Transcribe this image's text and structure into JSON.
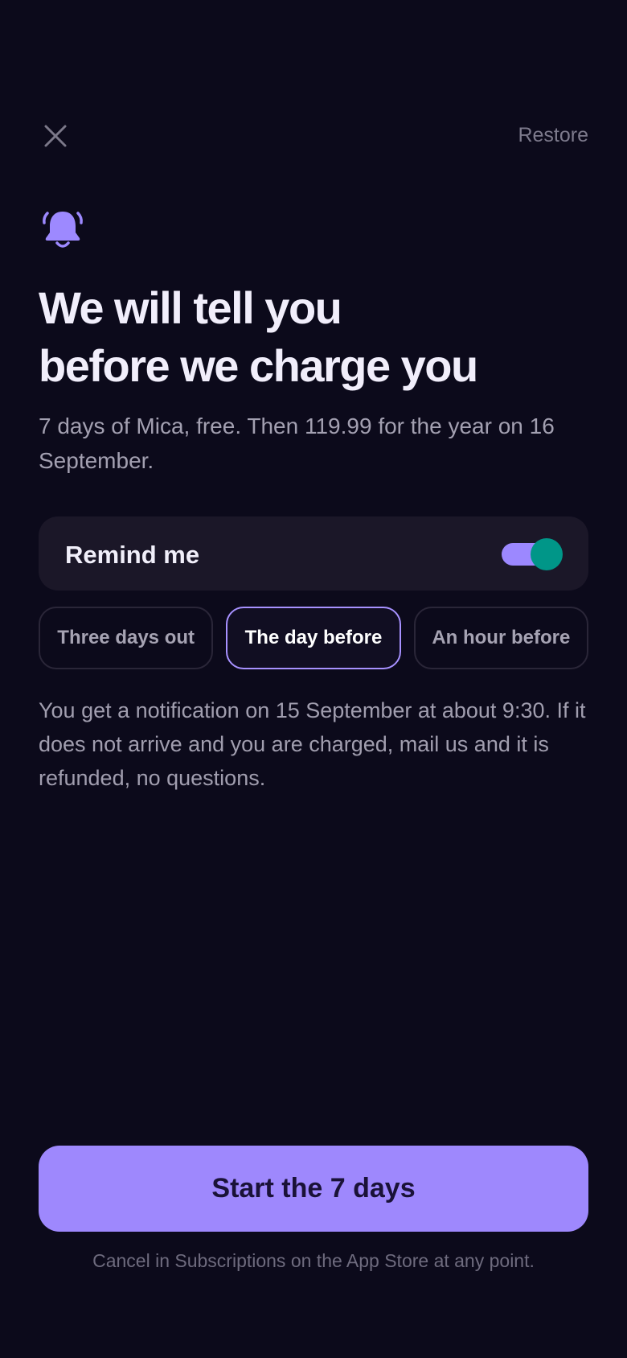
{
  "header": {
    "close_icon": "close-icon",
    "restore_label": "Restore"
  },
  "hero": {
    "icon": "bell-icon",
    "icon_color": "#9d89ff",
    "title_line1": "We will tell you",
    "title_line2": "before we charge you",
    "subtitle": "7 days of Mica, free. Then 119.99 for the year on 16 September."
  },
  "reminder": {
    "label": "Remind me",
    "enabled": true,
    "options": [
      {
        "label": "Three days out",
        "selected": false
      },
      {
        "label": "The day before",
        "selected": true
      },
      {
        "label": "An hour before",
        "selected": false
      }
    ],
    "notice": "You get a notification on 15 September at about 9:30. If it does not arrive and you are charged, mail us and it is refunded, no questions."
  },
  "footer": {
    "cta_label": "Start the 7 days",
    "note": "Cancel in Subscriptions on the App Store at any point."
  },
  "colors": {
    "background": "#0c0a1b",
    "accent": "#9e88fd",
    "toggle_thumb": "#009688",
    "card": "#1b1728"
  }
}
